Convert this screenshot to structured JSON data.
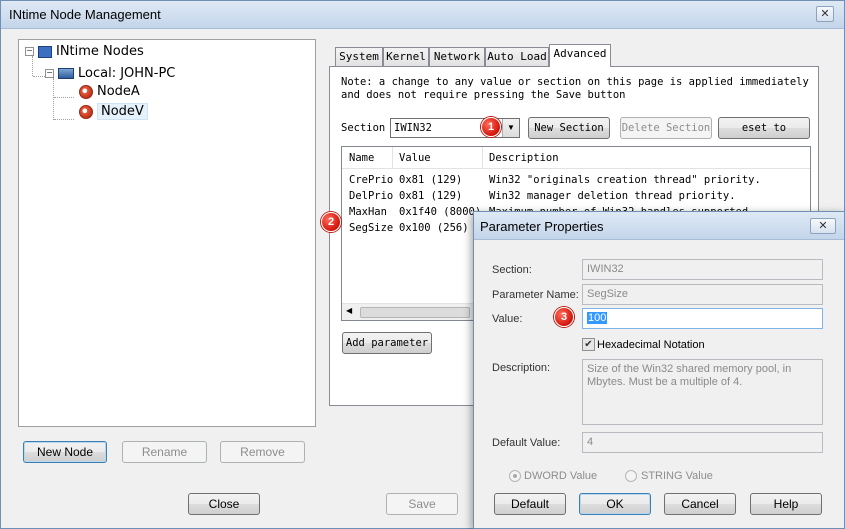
{
  "window": {
    "title": "INtime Node Management",
    "close_glyph": "✕"
  },
  "tree": {
    "root": "INtime Nodes",
    "host": "Local: JOHN-PC",
    "nodes": [
      "NodeA",
      "NodeV"
    ],
    "selected": "NodeV"
  },
  "left_buttons": {
    "new_node": "New Node",
    "rename": "Rename",
    "remove": "Remove"
  },
  "bottom_buttons": {
    "close": "Close",
    "save": "Save"
  },
  "tabs": [
    "System",
    "Kernel",
    "Network",
    "Auto Load",
    "Advanced"
  ],
  "active_tab": "Advanced",
  "advanced": {
    "note": "Note: a change to any value or section on this page is applied immediately and does not require pressing the Save button",
    "section_label": "Section",
    "section_value": "IWIN32",
    "new_section": "New Section",
    "delete_section": "Delete Section",
    "reset_default": "eset to Default",
    "columns": [
      "Name",
      "Value",
      "Description"
    ],
    "rows": [
      {
        "name": "CrePrio",
        "value": "0x81 (129)",
        "desc": "Win32 \"originals creation thread\" priority."
      },
      {
        "name": "DelPrio",
        "value": "0x81 (129)",
        "desc": "Win32 manager deletion thread priority."
      },
      {
        "name": "MaxHan",
        "value": "0x1f40 (8000)",
        "desc": "Maximum number of Win32 handles supported"
      },
      {
        "name": "SegSize",
        "value": "0x100 (256)",
        "desc": ""
      }
    ],
    "add_parameter": "Add parameter"
  },
  "callouts": [
    "1",
    "2",
    "3"
  ],
  "dialog": {
    "title": "Parameter Properties",
    "close_glyph": "✕",
    "section_label": "Section:",
    "section_value": "IWIN32",
    "param_label": "Parameter Name:",
    "param_value": "SegSize",
    "value_label": "Value:",
    "value_value": "100",
    "hex_label": "Hexadecimal Notation",
    "hex_checked": true,
    "desc_label": "Description:",
    "desc_value": "Size of the Win32 shared memory pool, in Mbytes. Must be a multiple of 4.",
    "default_label": "Default Value:",
    "default_value": "4",
    "radio_dword": "DWORD Value",
    "radio_string": "STRING Value",
    "buttons": {
      "default": "Default",
      "ok": "OK",
      "cancel": "Cancel",
      "help": "Help"
    }
  },
  "colors": {
    "title_bg": "#c4d5ea",
    "callout": "#d2140a",
    "selection": "#3399ff"
  }
}
